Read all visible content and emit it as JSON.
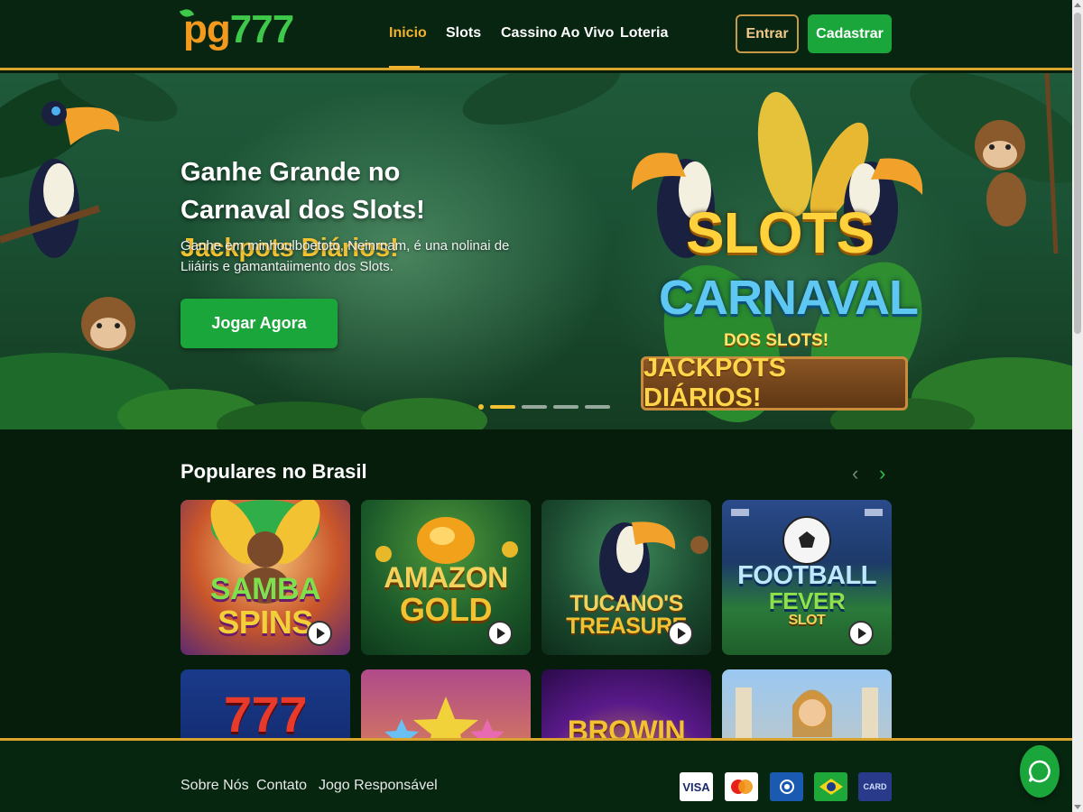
{
  "header": {
    "logo_pg": "pg",
    "logo_num": "777",
    "nav": [
      {
        "label": "Inicio",
        "active": true
      },
      {
        "label": "Slots",
        "active": false
      },
      {
        "label": "Cassino Ao Vivo",
        "active": false
      },
      {
        "label": "Loteria",
        "active": false
      }
    ],
    "login_label": "Entrar",
    "register_label": "Cadastrar"
  },
  "hero": {
    "title_part1": "Ganhe Grande no Carnaval dos Slots!",
    "title_highlight": "Jackpots Diários!",
    "description": "Ganhe em minhoulboetoto, Neinrnam, é una nolinai de Liiáiris e gamantaiimento dos Slots.",
    "cta_label": "Jogar Agora",
    "banner_slots": "SLOTS",
    "banner_carnaval": "CARNAVAL",
    "banner_dos": "DOS SLOTS!",
    "banner_jackpots": "JACKPOTS DIÁRIOS!",
    "slide_count": 5,
    "active_slide": 0
  },
  "popular": {
    "title": "Populares no Brasil",
    "prev_icon": "chevron-left-icon",
    "next_icon": "chevron-right-icon",
    "games": [
      {
        "title_line1": "SAMBA",
        "title_line2": "SPINS"
      },
      {
        "title_line1": "AMAZON",
        "title_line2": "GOLD"
      },
      {
        "title_line1": "TUCANO'S",
        "title_line2": "TREASURE"
      },
      {
        "title_line1": "FOOTBALL",
        "title_line2": "FEVER",
        "title_line3": "SLOT"
      }
    ],
    "games_row2": [
      {
        "title_line1": "777"
      },
      {
        "title_line1": ""
      },
      {
        "title_line1": "BROWIN"
      },
      {
        "title_line1": ""
      }
    ]
  },
  "footer": {
    "links": [
      "Sobre Nós",
      "Contato",
      "Jogo Responsável"
    ],
    "payments": [
      "VISA",
      "mastercard",
      "",
      "",
      "CARD"
    ]
  },
  "colors": {
    "accent_gold": "#f2b12e",
    "primary_green": "#1aa63a",
    "header_bg": "#072510",
    "page_bg": "#061d0c"
  }
}
